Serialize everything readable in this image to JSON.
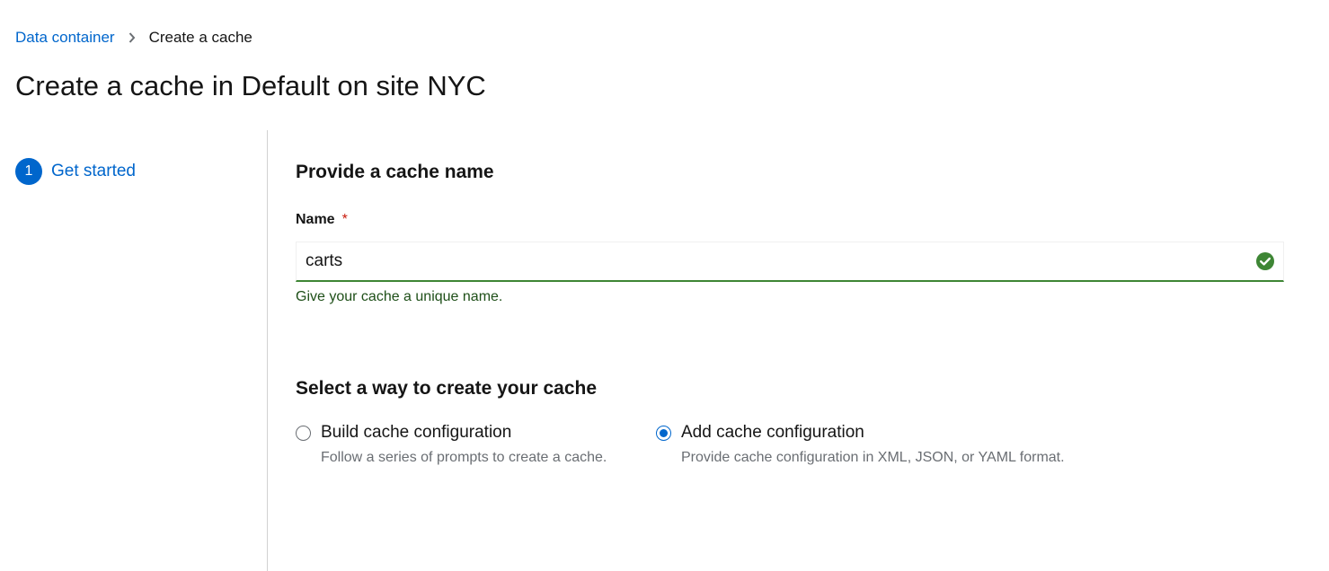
{
  "breadcrumb": {
    "parent": "Data container",
    "current": "Create a cache"
  },
  "page": {
    "title": "Create a cache in Default on site NYC"
  },
  "wizard_nav": {
    "steps": [
      {
        "number": "1",
        "label": "Get started"
      }
    ]
  },
  "name_section": {
    "title": "Provide a cache name",
    "field_label": "Name",
    "required_marker": "*",
    "value": "carts",
    "helper_text": "Give your cache a unique name.",
    "status": "valid"
  },
  "method_section": {
    "title": "Select a way to create your cache",
    "options": [
      {
        "label": "Build cache configuration",
        "description": "Follow a series of prompts to create a cache.",
        "checked": false
      },
      {
        "label": "Add cache configuration",
        "description": "Provide cache configuration in XML, JSON, or YAML format.",
        "checked": true
      }
    ]
  },
  "colors": {
    "link": "#0066cc",
    "success": "#3e8635",
    "required": "#c9190b"
  },
  "icons": {
    "breadcrumb_separator": "chevron-right-icon",
    "valid": "check-circle-icon"
  }
}
